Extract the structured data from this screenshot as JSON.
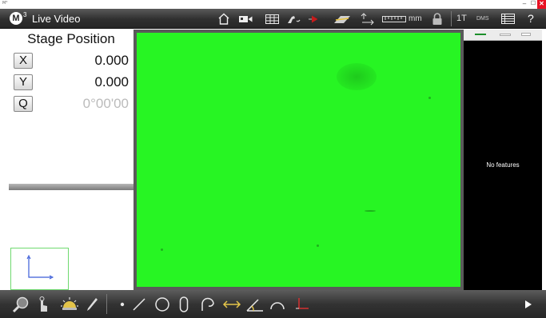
{
  "window": {
    "app_tiny_label": "M³",
    "min_glyph": "–",
    "max_glyph": "☐",
    "close_glyph": "✕"
  },
  "toolbar": {
    "logo_letter": "M",
    "logo_sup": "3",
    "title": "Live Video",
    "units": "mm",
    "mode_label": "1T",
    "angle_format": "DMS",
    "help_label": "?"
  },
  "stage": {
    "title": "Stage Position",
    "axes": [
      {
        "button": "X",
        "value": "0.000",
        "enabled": true
      },
      {
        "button": "Y",
        "value": "0.000",
        "enabled": true
      },
      {
        "button": "Q",
        "value": "0°00'00",
        "enabled": false
      }
    ]
  },
  "features_panel": {
    "empty_message": "No features"
  },
  "colors": {
    "video_green": "#27f523",
    "toolbar_dark": "#2f2f2f",
    "close_red": "#e81123",
    "preview_border": "#6fd96f",
    "axis_blue": "#3a5cd8"
  },
  "bottom_toolbar": {
    "tools": [
      "zoom-icon",
      "touch-icon",
      "light-icon",
      "probe-icon"
    ],
    "features": [
      "point-icon",
      "line-icon",
      "circle-icon",
      "slot-icon",
      "arc-contour-icon",
      "distance-icon",
      "angle-icon",
      "arc-icon",
      "origin-icon"
    ],
    "expand": "play-arrow-icon"
  }
}
